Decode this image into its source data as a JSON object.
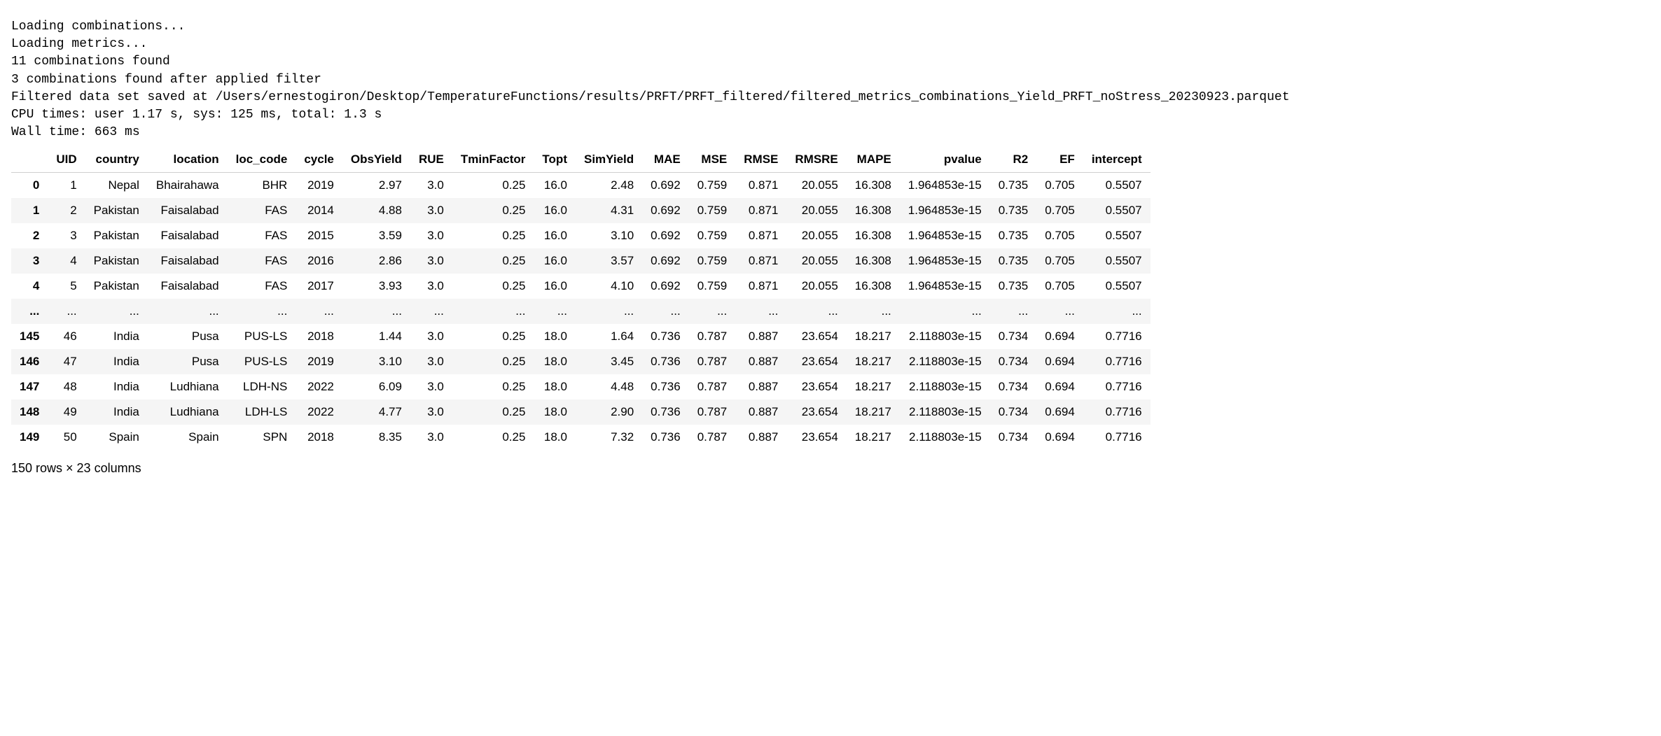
{
  "log_lines": [
    "Loading combinations...",
    "Loading metrics...",
    "11 combinations found",
    "3 combinations found after applied filter",
    "Filtered data set saved at /Users/ernestogiron/Desktop/TemperatureFunctions/results/PRFT/PRFT_filtered/filtered_metrics_combinations_Yield_PRFT_noStress_20230923.parquet",
    "CPU times: user 1.17 s, sys: 125 ms, total: 1.3 s",
    "Wall time: 663 ms"
  ],
  "columns": [
    "UID",
    "country",
    "location",
    "loc_code",
    "cycle",
    "ObsYield",
    "RUE",
    "TminFactor",
    "Topt",
    "SimYield",
    "MAE",
    "MSE",
    "RMSE",
    "RMSRE",
    "MAPE",
    "pvalue",
    "R2",
    "EF",
    "intercept"
  ],
  "rows": [
    {
      "idx": "0",
      "cells": [
        "1",
        "Nepal",
        "Bhairahawa",
        "BHR",
        "2019",
        "2.97",
        "3.0",
        "0.25",
        "16.0",
        "2.48",
        "0.692",
        "0.759",
        "0.871",
        "20.055",
        "16.308",
        "1.964853e-15",
        "0.735",
        "0.705",
        "0.5507"
      ]
    },
    {
      "idx": "1",
      "cells": [
        "2",
        "Pakistan",
        "Faisalabad",
        "FAS",
        "2014",
        "4.88",
        "3.0",
        "0.25",
        "16.0",
        "4.31",
        "0.692",
        "0.759",
        "0.871",
        "20.055",
        "16.308",
        "1.964853e-15",
        "0.735",
        "0.705",
        "0.5507"
      ]
    },
    {
      "idx": "2",
      "cells": [
        "3",
        "Pakistan",
        "Faisalabad",
        "FAS",
        "2015",
        "3.59",
        "3.0",
        "0.25",
        "16.0",
        "3.10",
        "0.692",
        "0.759",
        "0.871",
        "20.055",
        "16.308",
        "1.964853e-15",
        "0.735",
        "0.705",
        "0.5507"
      ]
    },
    {
      "idx": "3",
      "cells": [
        "4",
        "Pakistan",
        "Faisalabad",
        "FAS",
        "2016",
        "2.86",
        "3.0",
        "0.25",
        "16.0",
        "3.57",
        "0.692",
        "0.759",
        "0.871",
        "20.055",
        "16.308",
        "1.964853e-15",
        "0.735",
        "0.705",
        "0.5507"
      ]
    },
    {
      "idx": "4",
      "cells": [
        "5",
        "Pakistan",
        "Faisalabad",
        "FAS",
        "2017",
        "3.93",
        "3.0",
        "0.25",
        "16.0",
        "4.10",
        "0.692",
        "0.759",
        "0.871",
        "20.055",
        "16.308",
        "1.964853e-15",
        "0.735",
        "0.705",
        "0.5507"
      ]
    },
    {
      "idx": "...",
      "cells": [
        "...",
        "...",
        "...",
        "...",
        "...",
        "...",
        "...",
        "...",
        "...",
        "...",
        "...",
        "...",
        "...",
        "...",
        "...",
        "...",
        "...",
        "...",
        "..."
      ]
    },
    {
      "idx": "145",
      "cells": [
        "46",
        "India",
        "Pusa",
        "PUS-LS",
        "2018",
        "1.44",
        "3.0",
        "0.25",
        "18.0",
        "1.64",
        "0.736",
        "0.787",
        "0.887",
        "23.654",
        "18.217",
        "2.118803e-15",
        "0.734",
        "0.694",
        "0.7716"
      ]
    },
    {
      "idx": "146",
      "cells": [
        "47",
        "India",
        "Pusa",
        "PUS-LS",
        "2019",
        "3.10",
        "3.0",
        "0.25",
        "18.0",
        "3.45",
        "0.736",
        "0.787",
        "0.887",
        "23.654",
        "18.217",
        "2.118803e-15",
        "0.734",
        "0.694",
        "0.7716"
      ]
    },
    {
      "idx": "147",
      "cells": [
        "48",
        "India",
        "Ludhiana",
        "LDH-NS",
        "2022",
        "6.09",
        "3.0",
        "0.25",
        "18.0",
        "4.48",
        "0.736",
        "0.787",
        "0.887",
        "23.654",
        "18.217",
        "2.118803e-15",
        "0.734",
        "0.694",
        "0.7716"
      ]
    },
    {
      "idx": "148",
      "cells": [
        "49",
        "India",
        "Ludhiana",
        "LDH-LS",
        "2022",
        "4.77",
        "3.0",
        "0.25",
        "18.0",
        "2.90",
        "0.736",
        "0.787",
        "0.887",
        "23.654",
        "18.217",
        "2.118803e-15",
        "0.734",
        "0.694",
        "0.7716"
      ]
    },
    {
      "idx": "149",
      "cells": [
        "50",
        "Spain",
        "Spain",
        "SPN",
        "2018",
        "8.35",
        "3.0",
        "0.25",
        "18.0",
        "7.32",
        "0.736",
        "0.787",
        "0.887",
        "23.654",
        "18.217",
        "2.118803e-15",
        "0.734",
        "0.694",
        "0.7716"
      ]
    }
  ],
  "footer": "150 rows × 23 columns"
}
